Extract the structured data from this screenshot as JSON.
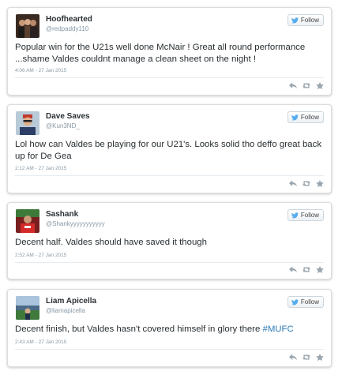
{
  "colors": {
    "twitter_blue": "#55acee",
    "hashtag": "#2b7bb9",
    "muted": "#8899a6",
    "icon_gray": "#9aa5ad"
  },
  "tweets": [
    {
      "name": "Hoofhearted",
      "handle": "@redpaddy110",
      "follow_label": "Follow",
      "text": "Popular win for the U21s well done McNair ! Great all round performance ...shame Valdes couldnt manage a clean sheet on the night !",
      "timestamp": "4:06 AM - 27 Jan 2015"
    },
    {
      "name": "Dave Saves",
      "handle": "@Kun3ND_",
      "follow_label": "Follow",
      "text": "Lol how can Valdes be playing for our U21's. Looks solid tho deffo great back up for De Gea",
      "timestamp": "2:12 AM - 27 Jan 2015"
    },
    {
      "name": "Sashank",
      "handle": "@Shankyyyyyyyyyyy",
      "follow_label": "Follow",
      "text": "Decent half. Valdes should have saved it though",
      "timestamp": "2:52 AM - 27 Jan 2015"
    },
    {
      "name": "Liam Apicella",
      "handle": "@liamapicella",
      "follow_label": "Follow",
      "text": "Decent finish, but Valdes hasn't covered himself in glory there ",
      "hashtag": "#MUFC",
      "timestamp": "2:43 AM - 27 Jan 2015"
    }
  ],
  "icons": {
    "follow": "twitter-bird-icon",
    "reply": "reply-icon",
    "retweet": "retweet-icon",
    "favorite": "favorite-star-icon"
  }
}
